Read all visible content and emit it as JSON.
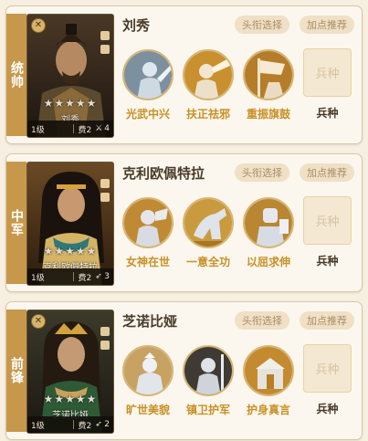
{
  "generals": [
    {
      "position": "统帅",
      "name": "刘秀",
      "portrait_name": "刘秀",
      "stars": "★★★★★",
      "level": "1级",
      "cost": "费2",
      "unit_count": "4",
      "skills": [
        {
          "label": "光武中兴",
          "icon": "emperor-statue-icon"
        },
        {
          "label": "扶正祛邪",
          "icon": "horn-warrior-icon"
        },
        {
          "label": "重振旗鼓",
          "icon": "battle-flag-icon"
        }
      ]
    },
    {
      "position": "中军",
      "name": "克利欧佩特拉",
      "portrait_name": "克利欧佩特拉",
      "stars": "★★★★★",
      "level": "1级",
      "cost": "费2",
      "unit_count": "3",
      "skills": [
        {
          "label": "女神在世",
          "icon": "goddess-statue-icon"
        },
        {
          "label": "一意全功",
          "icon": "rearing-horse-icon"
        },
        {
          "label": "以屈求伸",
          "icon": "armored-knight-icon"
        }
      ]
    },
    {
      "position": "前锋",
      "name": "芝诺比娅",
      "portrait_name": "芝诺比娅",
      "stars": "★★★★★",
      "level": "1级",
      "cost": "费2",
      "unit_count": "2",
      "skills": [
        {
          "label": "旷世美貌",
          "icon": "queen-statue-icon"
        },
        {
          "label": "镇卫护军",
          "icon": "guard-soldier-icon"
        },
        {
          "label": "护身真言",
          "icon": "temple-altar-icon"
        }
      ]
    }
  ],
  "buttons": {
    "title_select": "头衔选择",
    "points_recommend": "加点推荐"
  },
  "troop": {
    "box_text": "兵种",
    "label": "兵种"
  },
  "colors": {
    "gold": "#c99026",
    "tab": "#c7984b",
    "card_border": "#d9c8a6"
  }
}
